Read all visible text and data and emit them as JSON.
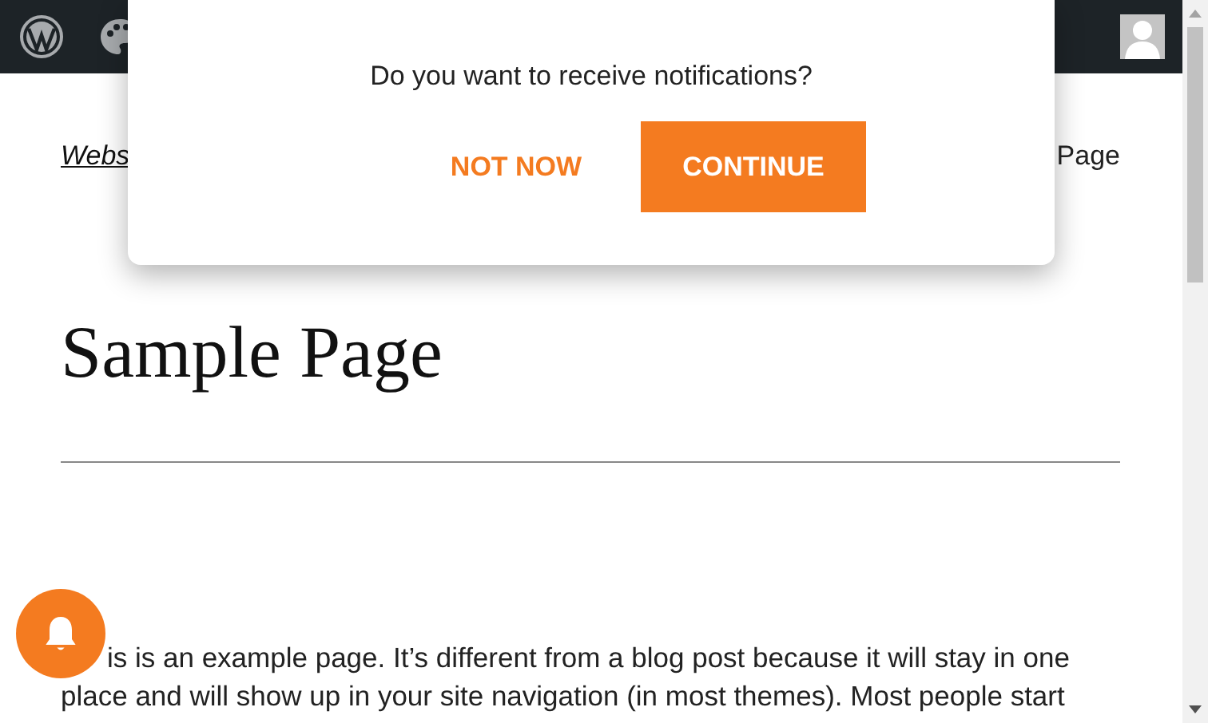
{
  "admin_bar": {
    "items": [
      {
        "kind": "logo"
      },
      {
        "kind": "customize"
      }
    ]
  },
  "breadcrumb": {
    "link": "Webs",
    "current": "Page"
  },
  "page": {
    "title": "Sample Page",
    "paragraph_lines": [
      "is is an example page. It’s different from a blog post because it will stay in one",
      "place and will show up in your site navigation (in most themes). Most people start"
    ]
  },
  "popup": {
    "message": "Do you want to receive notifications?",
    "buttons": [
      {
        "label": "NOT NOW",
        "kind": "text"
      },
      {
        "label": "CONTINUE",
        "kind": "primary"
      }
    ]
  },
  "bell": {
    "kind": "bell"
  }
}
